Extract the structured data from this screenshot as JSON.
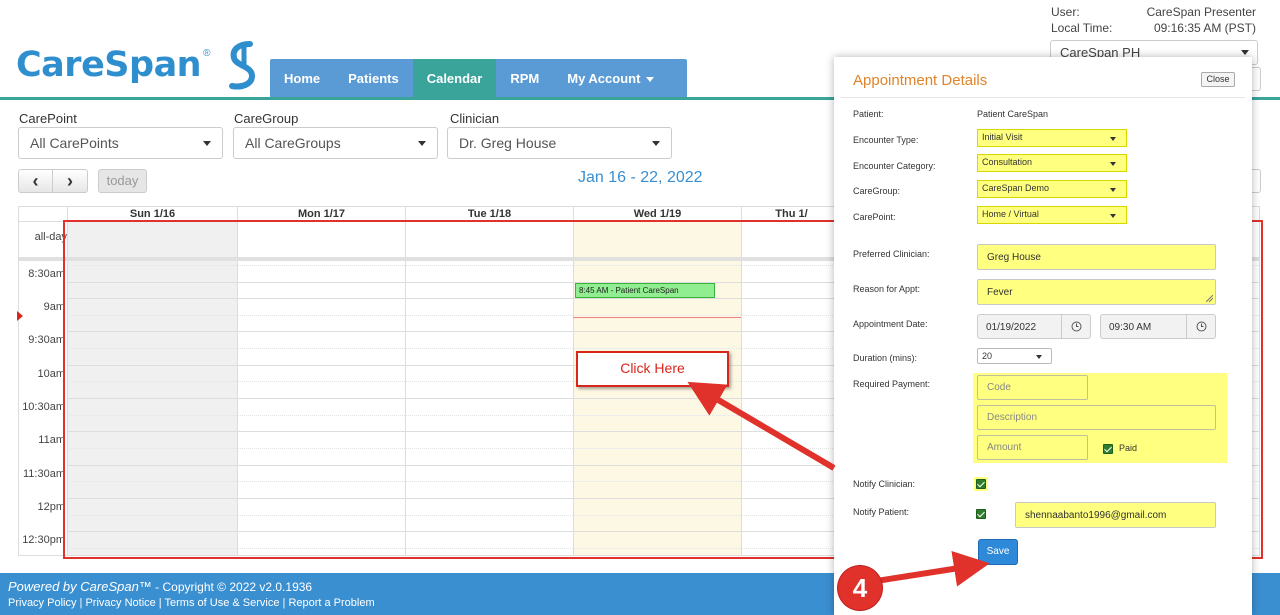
{
  "brand": {
    "name": "CareSpan",
    "reg": "®"
  },
  "nav": {
    "items": [
      {
        "label": "Home",
        "active": false
      },
      {
        "label": "Patients",
        "active": false
      },
      {
        "label": "Calendar",
        "active": true
      },
      {
        "label": "RPM",
        "active": false
      },
      {
        "label": "My Account",
        "active": false
      }
    ]
  },
  "user_info": {
    "user_label": "User:",
    "user_value": "CareSpan Presenter",
    "time_label": "Local Time:",
    "time_value": "09:16:35 AM (PST)",
    "org_selected": "CareSpan PH"
  },
  "filters": {
    "carepoint_label": "CarePoint",
    "carepoint_value": "All CarePoints",
    "caregroup_label": "CareGroup",
    "caregroup_value": "All CareGroups",
    "clinician_label": "Clinician",
    "clinician_value": "Dr. Greg House"
  },
  "toolbar": {
    "prev_icon": "‹",
    "next_icon": "›",
    "today_label": "today",
    "date_range": "Jan 16 - 22, 2022"
  },
  "calendar": {
    "days": [
      {
        "label": "Sun 1/16",
        "shaded": true
      },
      {
        "label": "Mon 1/17",
        "shaded": false
      },
      {
        "label": "Tue 1/18",
        "shaded": false
      },
      {
        "label": "Wed 1/19",
        "shaded": false,
        "today": true
      },
      {
        "label": "Thu 1/",
        "shaded": false
      }
    ],
    "allday_label": "all-day",
    "time_labels": [
      "8:30am",
      "9am",
      "9:30am",
      "10am",
      "10:30am",
      "11am",
      "11:30am",
      "12pm",
      "12:30pm"
    ],
    "event_text": "8:45 AM - Patient CareSpan"
  },
  "callouts": {
    "click_here": "Click Here",
    "step_number": "4"
  },
  "modal": {
    "title": "Appointment Details",
    "close_label": "Close",
    "patient_label": "Patient:",
    "patient_value": "Patient CareSpan",
    "encounter_type_label": "Encounter Type:",
    "encounter_type_value": "Initial Visit",
    "encounter_category_label": "Encounter Category:",
    "encounter_category_value": "Consultation",
    "caregroup_label": "CareGroup:",
    "caregroup_value": "CareSpan Demo",
    "carepoint_label": "CarePoint:",
    "carepoint_value": "Home / Virtual",
    "preferred_clinician_label": "Preferred Clinician:",
    "preferred_clinician_value": "Greg House",
    "reason_label": "Reason for Appt:",
    "reason_value": "Fever",
    "appt_date_label": "Appointment Date:",
    "appt_date_value": "01/19/2022",
    "appt_time_value": "09:30 AM",
    "duration_label": "Duration (mins):",
    "duration_value": "20",
    "payment_label": "Required Payment:",
    "code_placeholder": "Code",
    "description_placeholder": "Description",
    "amount_placeholder": "Amount",
    "paid_label": "Paid",
    "paid_checked": true,
    "notify_clinician_label": "Notify Clinician:",
    "notify_clinician_checked": true,
    "notify_patient_label": "Notify Patient:",
    "notify_patient_checked": true,
    "notify_email": "shennaabanto1996@gmail.com",
    "save_label": "Save"
  },
  "footer": {
    "powered_by": "Powered by CareSpan™",
    "copyright": " - Copyright © 2022 v2.0.1936",
    "links": [
      "Privacy Policy",
      "Privacy Notice",
      "Terms of Use & Service",
      "Report a Problem"
    ]
  },
  "colors": {
    "brand_blue": "#2f8fce",
    "nav_blue": "#5b9bd5",
    "nav_active_teal": "#3aa39a",
    "highlight_yellow": "#ffff80",
    "callout_red": "#e0312b",
    "event_green": "#90ee90"
  }
}
